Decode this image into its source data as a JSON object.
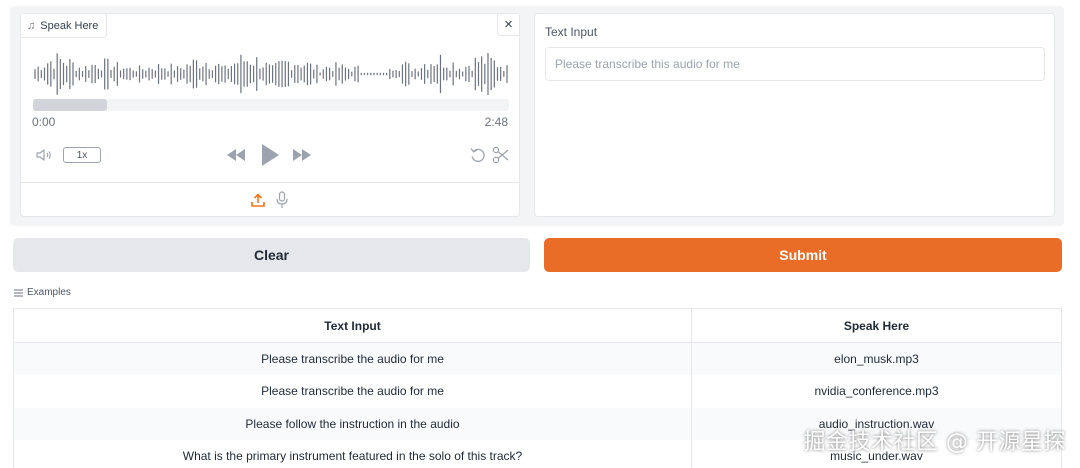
{
  "audio": {
    "label": "Speak Here",
    "close_label": "×",
    "time_start": "0:00",
    "time_end": "2:48",
    "speed": "1x",
    "progress_fraction": 0.155
  },
  "text_panel": {
    "label": "Text Input",
    "placeholder": "Please transcribe this audio for me",
    "value": ""
  },
  "buttons": {
    "clear": "Clear",
    "submit": "Submit"
  },
  "examples": {
    "title": "Examples",
    "headers": [
      "Text Input",
      "Speak Here"
    ],
    "rows": [
      [
        "Please transcribe the audio for me",
        "elon_musk.mp3"
      ],
      [
        "Please transcribe the audio for me",
        "nvidia_conference.mp3"
      ],
      [
        "Please follow the instruction in the audio",
        "audio_instruction.wav"
      ],
      [
        "What is the primary instrument featured in the solo of this track?",
        "music_under.wav"
      ]
    ]
  },
  "watermark": "掘金技术社区 @ 开源星探",
  "colors": {
    "accent": "#ea6d27",
    "accent_icon": "#f97316",
    "clear_bg": "#e5e7eb",
    "wave": "#6b7280"
  },
  "icons": [
    "music-note-icon",
    "close-icon",
    "volume-icon",
    "rewind-icon",
    "play-icon",
    "fast-forward-icon",
    "undo-icon",
    "scissors-icon",
    "upload-icon",
    "microphone-icon",
    "list-icon"
  ]
}
